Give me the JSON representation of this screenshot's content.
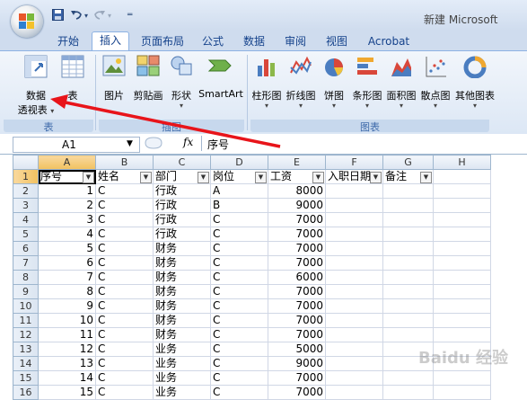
{
  "window": {
    "title": "新建 Microsoft"
  },
  "qat": {
    "save_icon": "save-icon",
    "undo_icon": "undo-icon",
    "redo_icon": "redo-icon",
    "customize": "customize-icon"
  },
  "tabs": [
    "开始",
    "插入",
    "页面布局",
    "公式",
    "数据",
    "审阅",
    "视图",
    "Acrobat"
  ],
  "active_tab": "插入",
  "ribbon": {
    "groups": {
      "tables": "表",
      "illustrations": "插图",
      "charts": "图表"
    },
    "tables_buttons": {
      "pivot_line1": "数据",
      "pivot_line2": "透视表",
      "table": "表"
    },
    "illustration_buttons": {
      "picture": "图片",
      "clipart": "剪贴画",
      "shapes": "形状",
      "smartart": "SmartArt"
    },
    "chart_buttons": [
      "柱形图",
      "折线图",
      "饼图",
      "条形图",
      "面积图",
      "散点图",
      "其他图表"
    ]
  },
  "formula_bar": {
    "name_box": "A1",
    "fx": "fx",
    "content": "序号"
  },
  "columns": [
    "A",
    "B",
    "C",
    "D",
    "E",
    "F",
    "G",
    "H"
  ],
  "headers": [
    "序号",
    "姓名",
    "部门",
    "岗位",
    "工资",
    "入职日期",
    "备注"
  ],
  "rows": [
    [
      "1",
      "C",
      "行政",
      "A",
      "8000"
    ],
    [
      "2",
      "C",
      "行政",
      "B",
      "9000"
    ],
    [
      "3",
      "C",
      "行政",
      "C",
      "7000"
    ],
    [
      "4",
      "C",
      "行政",
      "C",
      "7000"
    ],
    [
      "5",
      "C",
      "财务",
      "C",
      "7000"
    ],
    [
      "6",
      "C",
      "财务",
      "C",
      "7000"
    ],
    [
      "7",
      "C",
      "财务",
      "C",
      "6000"
    ],
    [
      "8",
      "C",
      "财务",
      "C",
      "7000"
    ],
    [
      "9",
      "C",
      "财务",
      "C",
      "7000"
    ],
    [
      "10",
      "C",
      "财务",
      "C",
      "7000"
    ],
    [
      "11",
      "C",
      "财务",
      "C",
      "7000"
    ],
    [
      "12",
      "C",
      "业务",
      "C",
      "5000"
    ],
    [
      "13",
      "C",
      "业务",
      "C",
      "9000"
    ],
    [
      "14",
      "C",
      "业务",
      "C",
      "7000"
    ],
    [
      "15",
      "C",
      "业务",
      "C",
      "7000"
    ]
  ],
  "row_numbers": [
    "1",
    "2",
    "3",
    "4",
    "5",
    "6",
    "7",
    "8",
    "9",
    "10",
    "11",
    "12",
    "13",
    "14",
    "15",
    "16"
  ],
  "watermark": "Baidu 经验",
  "colors": {
    "annotation_arrow": "#e8141a",
    "ribbon_text": "#15428b",
    "header_selected": "#f1c15f"
  }
}
